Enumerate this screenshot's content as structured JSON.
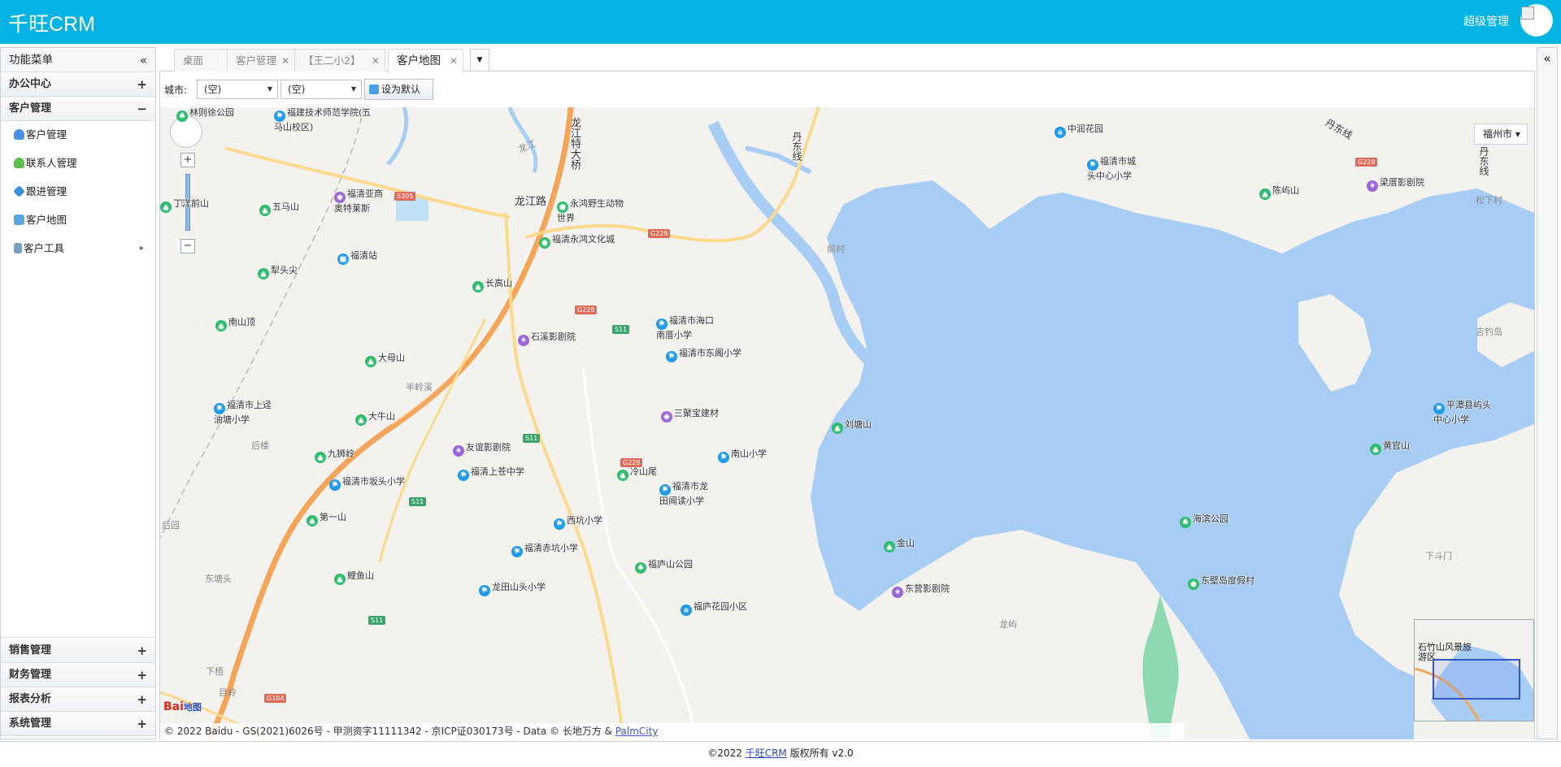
{
  "header": {
    "app_title": "千旺CRM",
    "user_name": "超级管理",
    "accent_color": "#03b3e3"
  },
  "sidebar": {
    "title": "功能菜单",
    "collapse_icon": "«",
    "sections": [
      {
        "label": "办公中心",
        "toggle": "+"
      },
      {
        "label": "客户管理",
        "toggle": "−"
      }
    ],
    "customer_items": [
      {
        "label": "客户管理",
        "icon": "user-icon"
      },
      {
        "label": "联系人管理",
        "icon": "contact-icon"
      },
      {
        "label": "跟进管理",
        "icon": "followup-icon"
      },
      {
        "label": "客户地图",
        "icon": "map-icon"
      },
      {
        "label": "客户工具",
        "icon": "tools-icon",
        "arrow": "▸"
      }
    ],
    "bottom_sections": [
      {
        "label": "销售管理",
        "toggle": "+"
      },
      {
        "label": "财务管理",
        "toggle": "+"
      },
      {
        "label": "报表分析",
        "toggle": "+"
      },
      {
        "label": "系统管理",
        "toggle": "+"
      }
    ]
  },
  "tabs": [
    {
      "label": "桌面",
      "closable": false,
      "active": false
    },
    {
      "label": "客户管理",
      "closable": true,
      "active": false
    },
    {
      "label": "【王二小2】",
      "closable": true,
      "active": false
    },
    {
      "label": "客户地图",
      "closable": true,
      "active": true
    }
  ],
  "toolbar": {
    "city_label": "城市:",
    "province_select": "(空)",
    "city_select": "(空)",
    "set_default_label": "设为默认"
  },
  "map": {
    "city_dropdown": "福州市",
    "copyright_text": "© 2022 Baidu - GS(2021)6026号 - 甲测资字11111342 - 京ICP证030173号 - Data © 长地万方 & ",
    "copyright_link": "PalmCity",
    "baidu_logo": "Bai",
    "baidu_logo_sub": "地图",
    "zoom_in": "+",
    "zoom_out": "−",
    "road_labels": [
      "龙江路",
      "龙江特大桥",
      "丹东线",
      "丹东线",
      "丹东线"
    ],
    "pois": [
      {
        "name": "林则徐公园",
        "type": "park"
      },
      {
        "name": "福建技术师范学院(五马山校区)",
        "type": "school"
      },
      {
        "name": "丁洋前山",
        "type": "mountain"
      },
      {
        "name": "五马山",
        "type": "mountain"
      },
      {
        "name": "福清亚商奥特莱斯",
        "type": "shop"
      },
      {
        "name": "永鸿野生动物世界",
        "type": "attraction"
      },
      {
        "name": "福清永鸿文化城",
        "type": "attraction"
      },
      {
        "name": "福清站",
        "type": "station"
      },
      {
        "name": "犁头尖",
        "type": "mountain"
      },
      {
        "name": "长高山",
        "type": "mountain"
      },
      {
        "name": "南山顶",
        "type": "mountain"
      },
      {
        "name": "石溪影剧院",
        "type": "cinema"
      },
      {
        "name": "大母山",
        "type": "mountain"
      },
      {
        "name": "福清市海口南厝小学",
        "type": "school"
      },
      {
        "name": "福清市东阁小学",
        "type": "school"
      },
      {
        "name": "福清市上迳油塘小学",
        "type": "school"
      },
      {
        "name": "大牛山",
        "type": "mountain"
      },
      {
        "name": "三聚宝建材",
        "type": "shop"
      },
      {
        "name": "刘塘山",
        "type": "mountain"
      },
      {
        "name": "九狮岭",
        "type": "mountain"
      },
      {
        "name": "友谊影剧院",
        "type": "cinema"
      },
      {
        "name": "福清上苍中学",
        "type": "school"
      },
      {
        "name": "冷山尾",
        "type": "mountain"
      },
      {
        "name": "南山小学",
        "type": "school"
      },
      {
        "name": "福清市坂头小学",
        "type": "school"
      },
      {
        "name": "福清市龙田闻读小学",
        "type": "school"
      },
      {
        "name": "第一山",
        "type": "mountain"
      },
      {
        "name": "西坑小学",
        "type": "school"
      },
      {
        "name": "福清赤坑小学",
        "type": "school"
      },
      {
        "name": "福庐山公园",
        "type": "park"
      },
      {
        "name": "金山",
        "type": "mountain"
      },
      {
        "name": "鲤鱼山",
        "type": "mountain"
      },
      {
        "name": "龙田山头小学",
        "type": "school"
      },
      {
        "name": "福庐花园小区",
        "type": "residential"
      },
      {
        "name": "东营影剧院",
        "type": "cinema"
      },
      {
        "name": "中润花园",
        "type": "residential"
      },
      {
        "name": "福清市城头中心小学",
        "type": "school"
      },
      {
        "name": "陈屿山",
        "type": "mountain"
      },
      {
        "name": "梁厝影剧院",
        "type": "cinema"
      },
      {
        "name": "平潭县屿头中心小学",
        "type": "school"
      },
      {
        "name": "黄官山",
        "type": "mountain"
      },
      {
        "name": "海滨公园",
        "type": "park"
      },
      {
        "name": "东壁岛度假村",
        "type": "resort"
      }
    ],
    "villages": [
      "前村",
      "半岭溪",
      "后楼",
      "后园",
      "东塘头",
      "下梧",
      "目岭",
      "吉钓岛",
      "松下村",
      "下斗门",
      "龙屿",
      "龙江"
    ],
    "road_shields": [
      "G228",
      "G228",
      "G228",
      "G228",
      "S11",
      "S11",
      "S11",
      "S11",
      "S305",
      "G104"
    ],
    "overview_labels": [
      "石竹山风景旅游区"
    ]
  },
  "footer": {
    "prefix": "©2022 ",
    "brand_link": "千旺CRM",
    "suffix": " 版权所有 v2.0"
  }
}
